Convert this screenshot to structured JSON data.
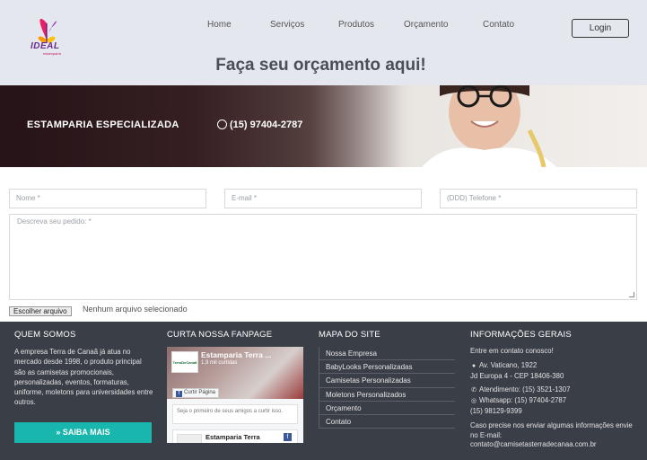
{
  "header": {
    "logo": {
      "word": "IDEAL",
      "sub": "estamparia"
    },
    "nav": [
      {
        "label": "Home"
      },
      {
        "label": "Serviços"
      },
      {
        "label": "Produtos"
      },
      {
        "label": "Orçamento"
      },
      {
        "label": "Contato"
      }
    ],
    "login_label": "Login",
    "page_title": "Faça seu orçamento aqui!"
  },
  "banner": {
    "text": "ESTAMPARIA ESPECIALIZADA",
    "phone": "(15) 97404-2787",
    "phone_icon": "whatsapp-icon"
  },
  "form": {
    "name_placeholder": "Nome *",
    "email_placeholder": "E-mail *",
    "phone_placeholder": "(DDD) Telefone *",
    "message_placeholder": "Descreva seu pedido: *",
    "file_button": "Escolher arquivo",
    "file_status": "Nenhum arquivo selecionado"
  },
  "footer": {
    "about": {
      "title": "QUEM SOMOS",
      "text": "A empresa Terra de Canaã já atua no mercado desde 1998, o produto principal são as camisetas promocionais, personalizadas, eventos, formaturas, uniforme, moletons para universidades entre outros.",
      "button": "» SAIBA MAIS"
    },
    "fanpage": {
      "title": "CURTA NOSSA FANPAGE",
      "page_name": "Estamparia Terra ...",
      "likes": "1,9 mil curtidas",
      "like_button": "Curtir Página",
      "post_text": "Seja o primeiro de seus amigos a curtir isso.",
      "post_name": "Estamparia Terra",
      "logo_text": "TerraDeCanaã"
    },
    "sitemap": {
      "title": "MAPA DO SITE",
      "items": [
        "Nossa Empresa",
        "BabyLooks Personalizadas",
        "Camisetas Personalizadas",
        "Moletons Personalizados",
        "Orçamento",
        "Contato"
      ]
    },
    "info": {
      "title": "INFORMAÇÕES GERAIS",
      "intro": "Entre em contato conosco!",
      "address_1": "Av. Vaticano, 1922",
      "address_2": "Jd Europa 4 - CEP 18406-380",
      "phone": "Atendimento: (15) 3521-1307",
      "whatsapp": "Whatsapp: (15) 97404-2787",
      "whatsapp_2": "(15) 98129-9399",
      "email_intro": "Caso precise nos enviar algumas informações envie no E-mail:",
      "email": "contato@camisetasterradecanaa.com.br"
    }
  },
  "colors": {
    "header_bg": "#e4e8ee",
    "footer_bg": "#3a3e47",
    "accent": "#18b6ad",
    "title": "#4a4f57"
  }
}
